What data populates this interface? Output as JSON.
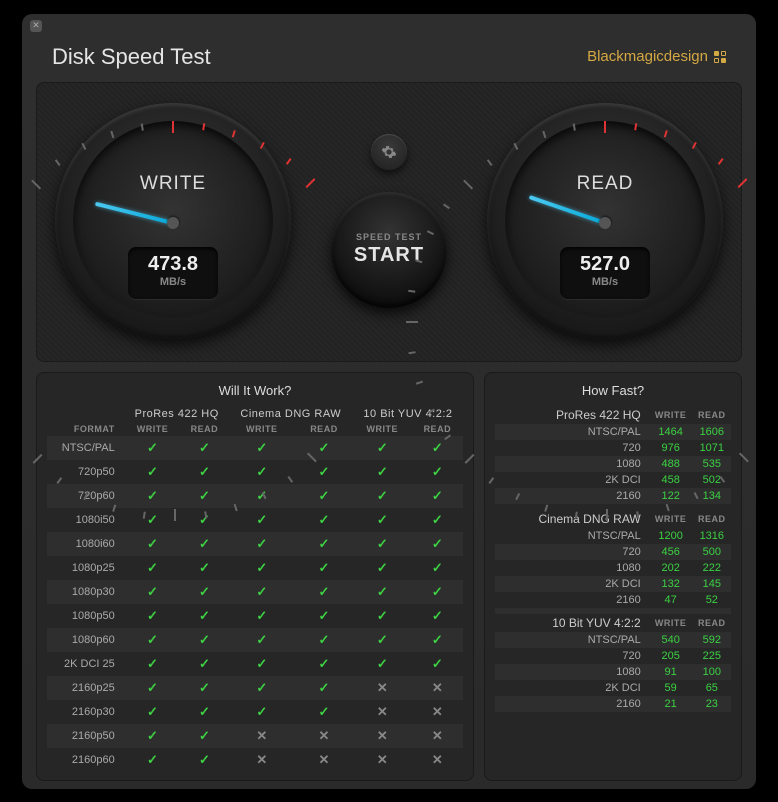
{
  "title": "Disk Speed Test",
  "brand": "Blackmagicdesign",
  "gauges": {
    "write": {
      "label": "WRITE",
      "value": "473.8",
      "unit": "MB/s",
      "needle_deg": 194
    },
    "read": {
      "label": "READ",
      "value": "527.0",
      "unit": "MB/s",
      "needle_deg": 199
    }
  },
  "settings_icon": "gear",
  "start": {
    "small": "SPEED TEST",
    "big": "START"
  },
  "will_it_work": {
    "title": "Will It Work?",
    "format_header": "FORMAT",
    "sub_headers": [
      "WRITE",
      "READ"
    ],
    "codecs": [
      "ProRes 422 HQ",
      "Cinema DNG RAW",
      "10 Bit YUV 4:2:2"
    ],
    "rows": [
      {
        "fmt": "NTSC/PAL",
        "cells": [
          1,
          1,
          1,
          1,
          1,
          1
        ]
      },
      {
        "fmt": "720p50",
        "cells": [
          1,
          1,
          1,
          1,
          1,
          1
        ]
      },
      {
        "fmt": "720p60",
        "cells": [
          1,
          1,
          1,
          1,
          1,
          1
        ]
      },
      {
        "fmt": "1080i50",
        "cells": [
          1,
          1,
          1,
          1,
          1,
          1
        ]
      },
      {
        "fmt": "1080i60",
        "cells": [
          1,
          1,
          1,
          1,
          1,
          1
        ]
      },
      {
        "fmt": "1080p25",
        "cells": [
          1,
          1,
          1,
          1,
          1,
          1
        ]
      },
      {
        "fmt": "1080p30",
        "cells": [
          1,
          1,
          1,
          1,
          1,
          1
        ]
      },
      {
        "fmt": "1080p50",
        "cells": [
          1,
          1,
          1,
          1,
          1,
          1
        ]
      },
      {
        "fmt": "1080p60",
        "cells": [
          1,
          1,
          1,
          1,
          1,
          1
        ]
      },
      {
        "fmt": "2K DCI 25",
        "cells": [
          1,
          1,
          1,
          1,
          1,
          1
        ]
      },
      {
        "fmt": "2160p25",
        "cells": [
          1,
          1,
          1,
          1,
          0,
          0
        ]
      },
      {
        "fmt": "2160p30",
        "cells": [
          1,
          1,
          1,
          1,
          0,
          0
        ]
      },
      {
        "fmt": "2160p50",
        "cells": [
          1,
          1,
          0,
          0,
          0,
          0
        ]
      },
      {
        "fmt": "2160p60",
        "cells": [
          1,
          1,
          0,
          0,
          0,
          0
        ]
      }
    ]
  },
  "how_fast": {
    "title": "How Fast?",
    "headers": [
      "WRITE",
      "READ"
    ],
    "groups": [
      {
        "codec": "ProRes 422 HQ",
        "rows": [
          {
            "fmt": "NTSC/PAL",
            "w": "1464",
            "r": "1606"
          },
          {
            "fmt": "720",
            "w": "976",
            "r": "1071"
          },
          {
            "fmt": "1080",
            "w": "488",
            "r": "535"
          },
          {
            "fmt": "2K DCI",
            "w": "458",
            "r": "502"
          },
          {
            "fmt": "2160",
            "w": "122",
            "r": "134"
          }
        ]
      },
      {
        "codec": "Cinema DNG RAW",
        "rows": [
          {
            "fmt": "NTSC/PAL",
            "w": "1200",
            "r": "1316"
          },
          {
            "fmt": "720",
            "w": "456",
            "r": "500"
          },
          {
            "fmt": "1080",
            "w": "202",
            "r": "222"
          },
          {
            "fmt": "2K DCI",
            "w": "132",
            "r": "145"
          },
          {
            "fmt": "2160",
            "w": "47",
            "r": "52"
          }
        ]
      },
      {
        "codec": "10 Bit YUV 4:2:2",
        "rows": [
          {
            "fmt": "NTSC/PAL",
            "w": "540",
            "r": "592"
          },
          {
            "fmt": "720",
            "w": "205",
            "r": "225"
          },
          {
            "fmt": "1080",
            "w": "91",
            "r": "100"
          },
          {
            "fmt": "2K DCI",
            "w": "59",
            "r": "65"
          },
          {
            "fmt": "2160",
            "w": "21",
            "r": "23"
          }
        ]
      }
    ]
  }
}
